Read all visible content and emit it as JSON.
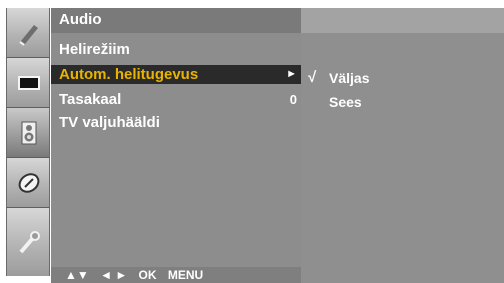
{
  "menu": {
    "title": "Audio",
    "items": [
      {
        "label": "Helirežiim",
        "value": ""
      },
      {
        "label": "Autom. helitugevus",
        "value": "►",
        "selected": true
      },
      {
        "label": "Tasakaal",
        "value": "0"
      },
      {
        "label": "TV valjuhääldi",
        "value": ""
      }
    ]
  },
  "submenu": {
    "options": [
      {
        "label": "Väljas",
        "check": "√",
        "checked": true
      },
      {
        "label": "Sees",
        "check": "",
        "checked": false
      }
    ]
  },
  "nav": {
    "updown": "▲▼",
    "leftright": "◄ ►",
    "ok": "OK",
    "menu": "MENU"
  },
  "icons": [
    "satellite-icon",
    "picture-icon",
    "speaker-icon",
    "clock-icon",
    "wrench-icon"
  ],
  "colors": {
    "highlight_text": "#e8b400",
    "highlight_bg": "#2a2a2a",
    "panel_bg": "#8d8d8d"
  }
}
